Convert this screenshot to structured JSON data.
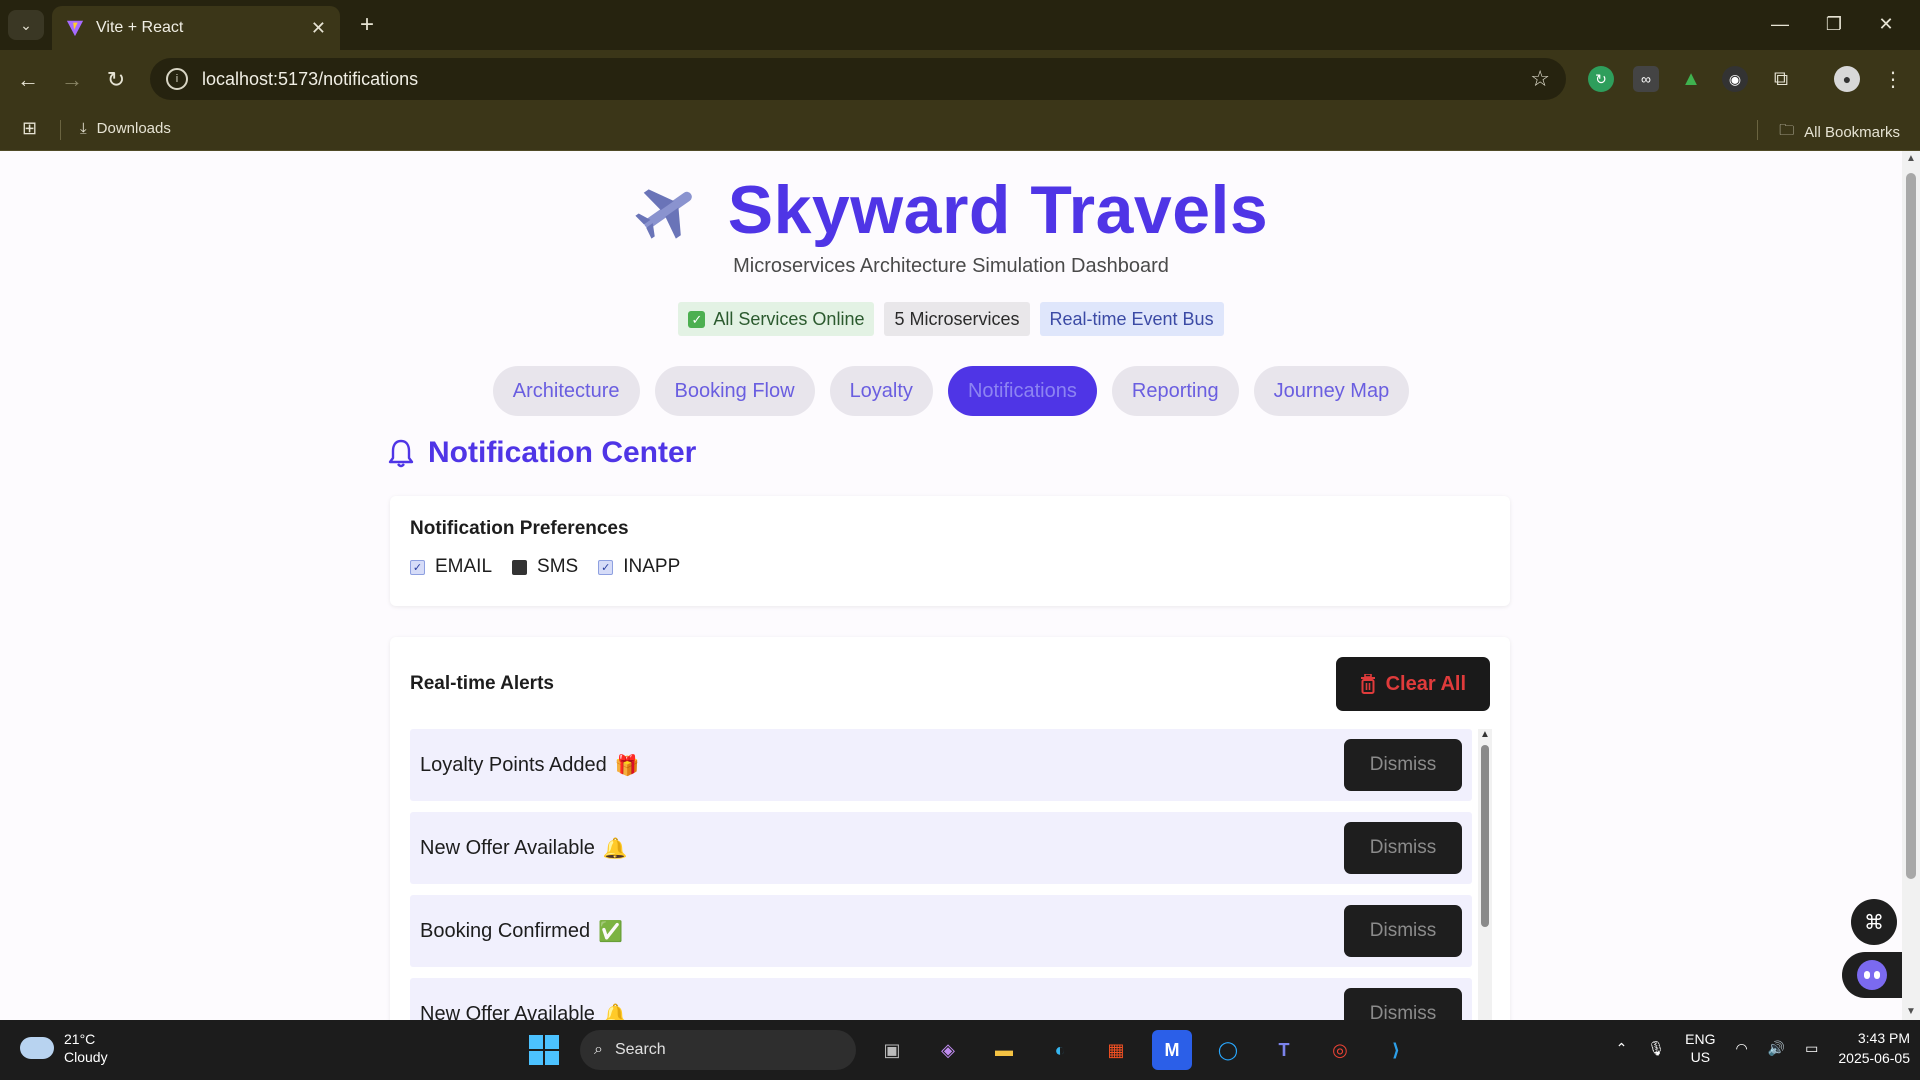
{
  "browser": {
    "tab_title": "Vite + React",
    "url": "localhost:5173/notifications",
    "bookmarks": {
      "downloads": "Downloads",
      "all_bookmarks": "All Bookmarks"
    }
  },
  "header": {
    "title": "Skyward Travels",
    "subtitle": "Microservices Architecture Simulation Dashboard",
    "badges": {
      "online": "All Services Online",
      "micro": "5 Microservices",
      "bus": "Real-time Event Bus"
    }
  },
  "nav": {
    "tabs": [
      {
        "label": "Architecture"
      },
      {
        "label": "Booking Flow"
      },
      {
        "label": "Loyalty"
      },
      {
        "label": "Notifications"
      },
      {
        "label": "Reporting"
      },
      {
        "label": "Journey Map"
      }
    ],
    "active": "Notifications"
  },
  "notifications": {
    "title": "Notification Center",
    "preferences": {
      "title": "Notification Preferences",
      "options": [
        {
          "label": "EMAIL",
          "checked": true
        },
        {
          "label": "SMS",
          "checked": false
        },
        {
          "label": "INAPP",
          "checked": true
        }
      ]
    },
    "alerts": {
      "title": "Real-time Alerts",
      "clear_label": "Clear All",
      "dismiss_label": "Dismiss",
      "items": [
        {
          "text": "Loyalty Points Added",
          "emoji": "🎁"
        },
        {
          "text": "New Offer Available",
          "emoji": "🔔"
        },
        {
          "text": "Booking Confirmed",
          "emoji": "✅"
        },
        {
          "text": "New Offer Available",
          "emoji": "🔔"
        }
      ]
    }
  },
  "taskbar": {
    "temperature": "21°C",
    "weather": "Cloudy",
    "search_placeholder": "Search",
    "lang_line1": "ENG",
    "lang_line2": "US",
    "time": "3:43 PM",
    "date": "2025-06-05"
  },
  "colors": {
    "brand": "#4f35e6",
    "danger": "#e03b3b"
  }
}
